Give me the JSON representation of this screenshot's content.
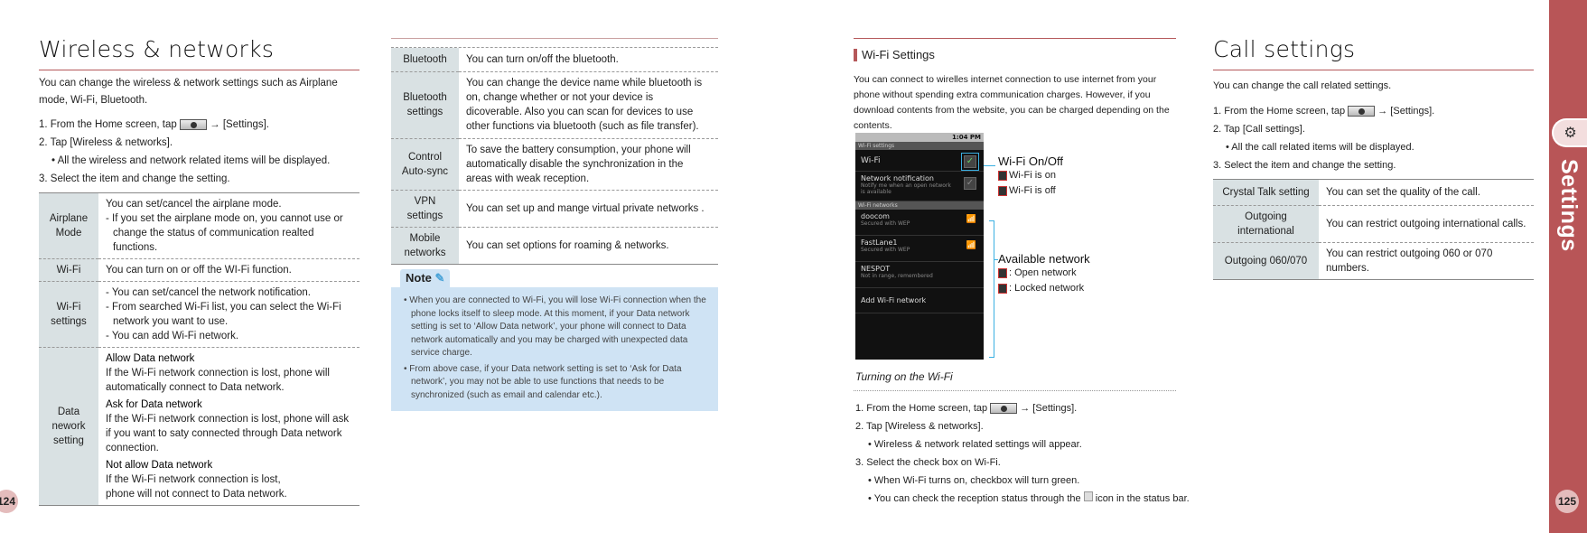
{
  "left": {
    "title": "Wireless & networks",
    "intro": "You can change the wireless & network settings such as Airplane mode, Wi-Fi, Bluetooth.",
    "steps": [
      {
        "pre": "1. From the Home screen, tap",
        "post": "→ [Settings]."
      },
      {
        "text": "2. Tap [Wireless & networks]."
      },
      {
        "text": "• All the wireless and network related items will be displayed."
      },
      {
        "text": "3.  Select the item and change the setting."
      }
    ],
    "table": [
      {
        "head": "Airplane Mode",
        "lines": [
          "You can set/cancel the airplane mode.",
          "- If you set the airplane mode on, you cannot use or change the status of communication realted functions."
        ]
      },
      {
        "head": "Wi-Fi",
        "lines": [
          "You can turn on or off the WI-Fi function."
        ]
      },
      {
        "head": "Wi-Fi settings",
        "lines": [
          "- You can set/cancel the network notification.",
          "- From searched Wi-Fi list, you can select the Wi-Fi network you want to use.",
          "- You can add Wi-Fi network."
        ]
      },
      {
        "head": "Data nework setting",
        "lines": [
          "Allow Data network",
          "If the Wi-Fi network connection is lost, phone will automatically connect to Data network.",
          "Ask for Data network",
          "If the Wi-Fi network connection is lost, phone will ask if you want to saty connected through Data network connection.",
          "Not allow Data network",
          "If the Wi-Fi network connection is lost, phone will not connect to Data network."
        ]
      }
    ],
    "page_number": "124"
  },
  "middle": {
    "table": [
      {
        "head": "Bluetooth",
        "text": "You can turn on/off the bluetooth."
      },
      {
        "head": "Bluetooth settings",
        "text": "You can change the device name while bluetooth is on, change whether or not your device is dicoverable. Also you can scan for devices to use other functions via bluetooth (such as file transfer)."
      },
      {
        "head": "Control Auto-sync",
        "text": "To save the battery consumption, your phone will automatically disable the synchronization in the areas with weak reception."
      },
      {
        "head": "VPN settings",
        "text": "You can set up and mange virtual private networks ."
      },
      {
        "head": "Mobile networks",
        "text": "You can set options for roaming & networks."
      }
    ],
    "note": {
      "label": "Note",
      "items": [
        "When you are connected to Wi-Fi, you will lose Wi-Fi connection when the phone locks itself to sleep mode. At this moment, if your Data network setting is set to ‘Allow Data network’, your phone will connect to Data network automatically and you may be charged with unexpected data service charge.",
        "From above case, if your Data network setting is set to ‘Ask for Data network’, you may not be able to use functions that needs to be synchronized (such as email and calendar etc.)."
      ]
    }
  },
  "wifi": {
    "heading": "Wi-Fi Settings",
    "intro": "You can connect to wirelles internet connection to use internet from your phone without spending extra communication charges. However, if you download contents from the website, you can be charged depending on the contents.",
    "phone": {
      "time": "1:04 PM",
      "title": "Wi-Fi settings",
      "wifi": "Wi-Fi",
      "notif": "Network notification",
      "notif_sub": "Notify me when an open network is available",
      "section": "Wi-Fi networks",
      "networks": [
        {
          "name": "doocom",
          "sub": "Secured with WEP"
        },
        {
          "name": "FastLane1",
          "sub": "Secured with WEP"
        },
        {
          "name": "NESPOT",
          "sub": "Not in range, remembered"
        }
      ],
      "add": "Add Wi-Fi network"
    },
    "annotations": {
      "onoff": "Wi-Fi On/Off",
      "on": "Wi-Fi is on",
      "off": "Wi-Fi is off",
      "avail": "Available network",
      "open": ": Open network",
      "locked": ": Locked network"
    },
    "caption": "Turning on the Wi-Fi",
    "steps": {
      "s1pre": "1. From the Home screen, tap",
      "s1post": "→ [Settings].",
      "s2": "2. Tap [Wireless & networks].",
      "s2b": "• Wireless & network related settings will appear.",
      "s3": "3.  Select the check box on Wi-Fi.",
      "s3a": "• When Wi-Fi turns on, checkbox will turn green.",
      "s3bpre": "• You can check the reception status through the",
      "s3bpost": "icon in the status bar."
    }
  },
  "call": {
    "title": "Call settings",
    "intro": "You can change the call related settings.",
    "s1pre": "1. From the Home screen, tap",
    "s1post": "→ [Settings].",
    "s2": "2. Tap [Call settings].",
    "s2b": "• All the call related items will be displayed.",
    "s3": "3.  Select the item and change the setting.",
    "table": [
      {
        "head": "Crystal Talk setting",
        "text": "You can set the quality of the call."
      },
      {
        "head": "Outgoing international",
        "text": "You can restrict outgoing international calls."
      },
      {
        "head": "Outgoing 060/070",
        "text": "You can restrict outgoing 060 or 070 numbers."
      }
    ],
    "page_number": "125"
  },
  "sidetab": {
    "label": "Settings",
    "color": "#b85557"
  }
}
